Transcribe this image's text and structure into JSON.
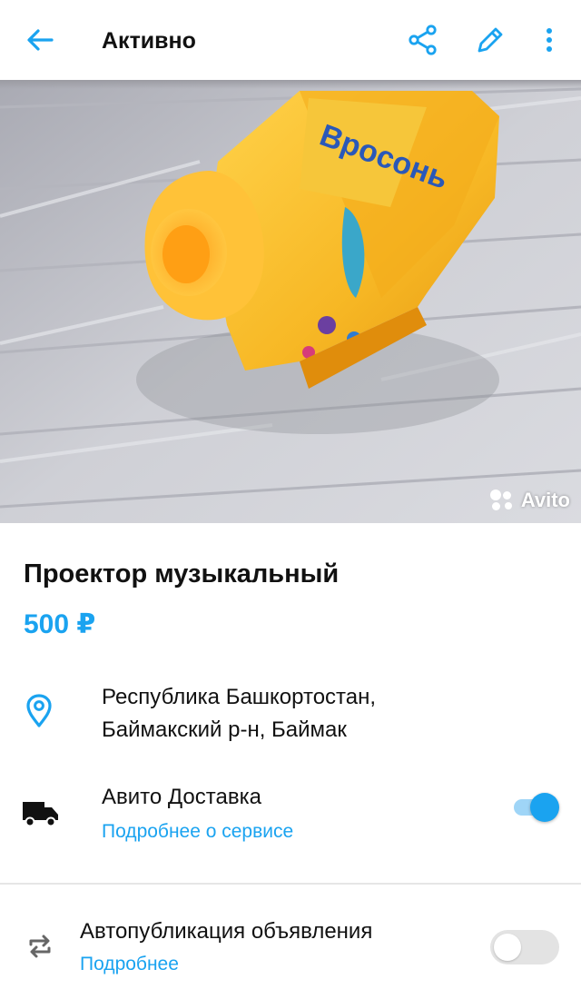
{
  "header": {
    "title": "Активно",
    "icons": [
      "back-arrow-icon",
      "share-icon",
      "edit-pencil-icon",
      "more-vertical-icon"
    ]
  },
  "photo": {
    "watermark": "Avito"
  },
  "product": {
    "title": "Проектор музыкальный",
    "price": "500 ₽"
  },
  "location": {
    "line1": "Республика Башкортостан,",
    "line2": "Баймакский р-н, Баймак",
    "icon": "location-pin-icon"
  },
  "delivery": {
    "label": "Авито Доставка",
    "link": "Подробнее о сервисе",
    "enabled": true,
    "icon": "truck-icon"
  },
  "autopublish": {
    "label": "Автопубликация объявления",
    "link": "Подробнее",
    "enabled": false,
    "icon": "repeat-icon"
  },
  "colors": {
    "accent": "#1aa3f0",
    "toggle_track_on": "#9fd5f7",
    "toggle_track_off": "#e3e3e3",
    "text": "#111111"
  }
}
